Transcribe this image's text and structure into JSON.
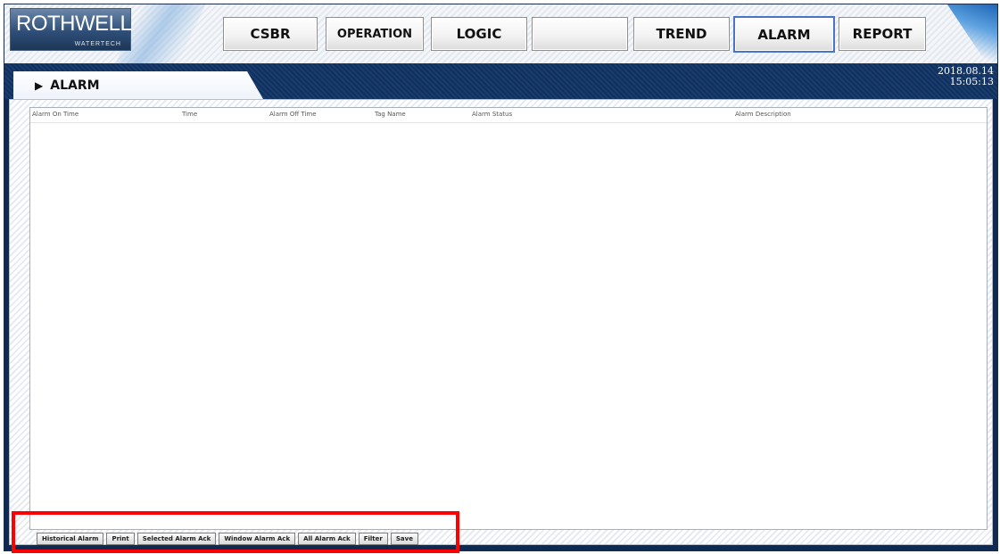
{
  "logo": {
    "main": "ROTHWELL",
    "sub": "WATERTECH"
  },
  "nav": {
    "csbr": "CSBR",
    "operation": "OPERATION",
    "logic": "LOGIC",
    "blank": "",
    "trend": "TREND",
    "alarm": "ALARM",
    "report": "REPORT",
    "active": "ALARM"
  },
  "title": {
    "label": "ALARM"
  },
  "datetime": {
    "date": "2018.08.14",
    "time": "15:05:13"
  },
  "table": {
    "columns": [
      "Alarm On Time",
      "Time",
      "Alarm Off Time",
      "Tag Name",
      "Alarm Status",
      "Alarm Description"
    ],
    "rows": []
  },
  "actions": {
    "historical": "Historical Alarm",
    "print": "Print",
    "selected_ack": "Selected Alarm Ack",
    "window_ack": "Window Alarm Ack",
    "all_ack": "All Alarm Ack",
    "filter": "Filter",
    "save": "Save"
  },
  "colors": {
    "highlight": "#ff0000",
    "active_border": "#4a74c9",
    "title_bar": "#10305e"
  }
}
